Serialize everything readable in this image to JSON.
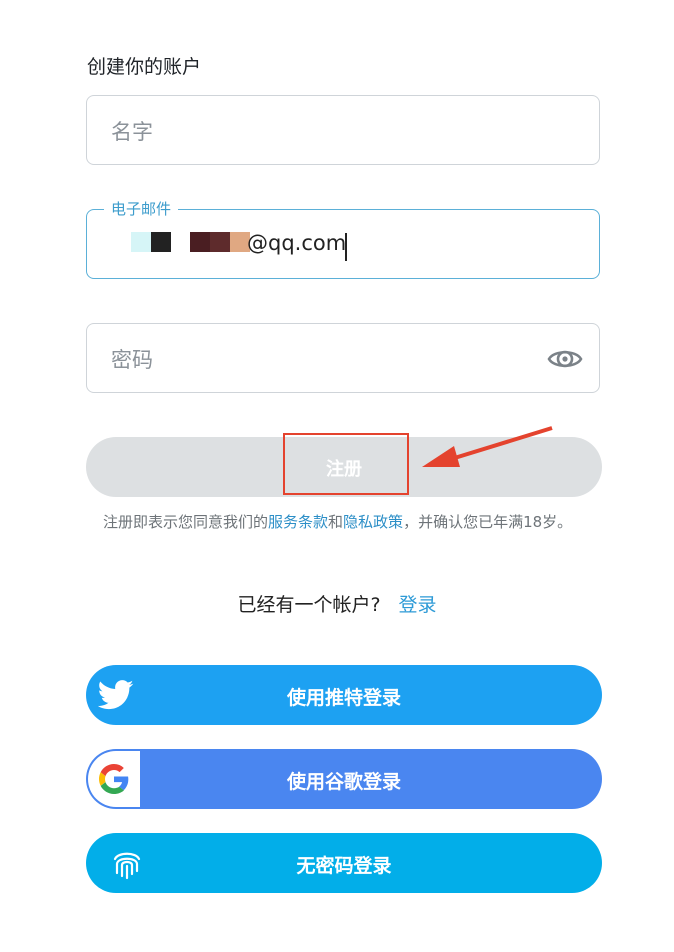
{
  "form": {
    "heading": "创建你的账户",
    "name_placeholder": "名字",
    "email_label": "电子邮件",
    "email_value": "@qq.com",
    "password_placeholder": "密码"
  },
  "signup_button": {
    "label": "注册"
  },
  "terms": {
    "prefix": "注册即表示您同意我们的",
    "terms_link": "服务条款",
    "and": "和",
    "privacy_link": "隐私政策",
    "suffix": "，并确认您已年满18岁。"
  },
  "login_prompt": {
    "text": "已经有一个帐户?",
    "link": "登录"
  },
  "social": {
    "twitter": "使用推特登录",
    "google": "使用谷歌登录",
    "passwordless": "无密码登录"
  },
  "icons": {
    "password_toggle": "eye-icon",
    "twitter": "twitter-bird-icon",
    "google": "google-g-icon",
    "passwordless": "fingerprint-icon"
  },
  "colors": {
    "twitter": "#1da1f2",
    "google": "#4a86f0",
    "passwordless": "#02aee9",
    "link": "#2d8fc7",
    "annotation": "#e4432e"
  }
}
